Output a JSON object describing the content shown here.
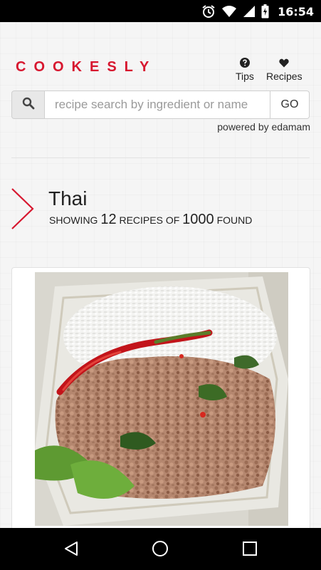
{
  "status_bar": {
    "time": "16:54",
    "icons": [
      "alarm-icon",
      "wifi-icon",
      "signal-icon",
      "battery-icon"
    ]
  },
  "header": {
    "logo": "COOKESLY",
    "nav": [
      {
        "label": "Tips",
        "icon": "question-circle-icon"
      },
      {
        "label": "Recipes",
        "icon": "heart-icon"
      }
    ]
  },
  "search": {
    "placeholder": "recipe search by ingredient or name",
    "value": "",
    "go_label": "GO",
    "powered_by": "powered by edamam"
  },
  "category": {
    "title": "Thai",
    "showing_label": "SHOWING",
    "shown_count": "12",
    "recipes_of_label": "RECIPES OF",
    "total_count": "1000",
    "found_label": "FOUND"
  },
  "recipe_card": {
    "image": "thai-basil-pork-photo"
  },
  "navigation_bar": {
    "buttons": [
      "back-icon",
      "home-icon",
      "recents-icon"
    ]
  },
  "colors": {
    "brand": "#d7172f",
    "status_bar": "#000000",
    "page_bg": "#f5f5f5"
  }
}
